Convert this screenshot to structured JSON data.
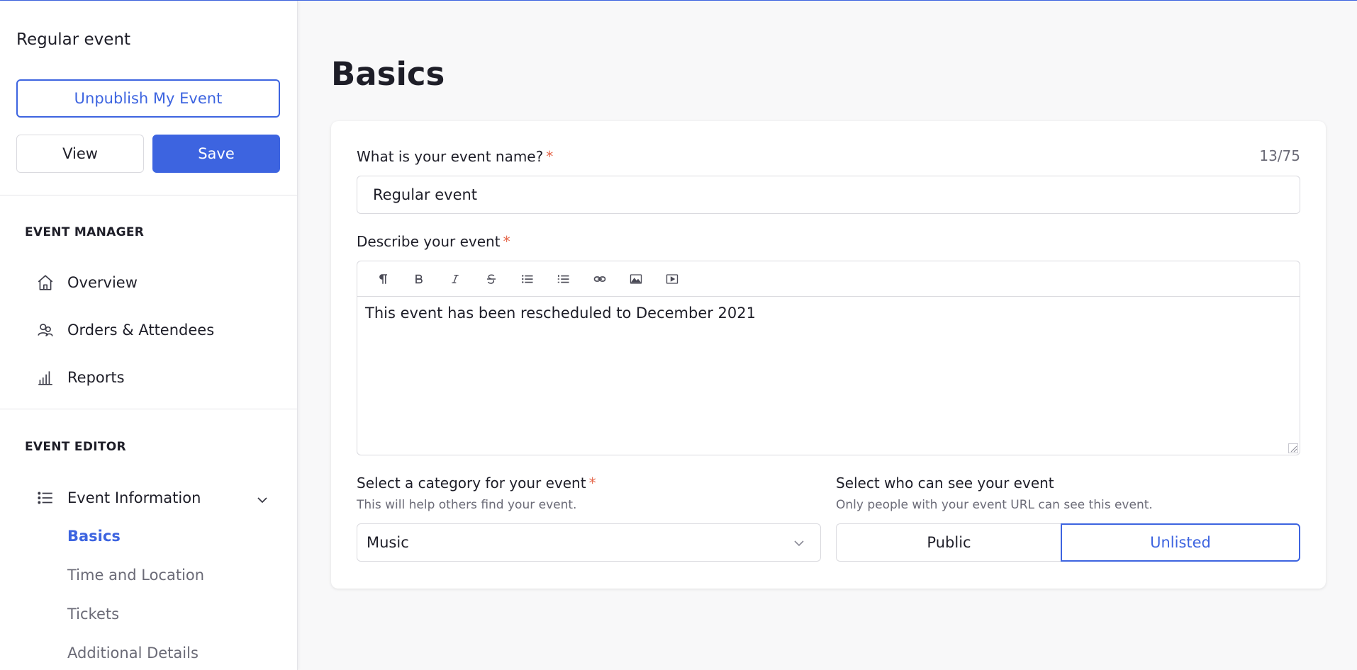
{
  "sidebar": {
    "event_title": "Regular event",
    "unpublish_label": "Unpublish My Event",
    "view_label": "View",
    "save_label": "Save",
    "manager_heading": "EVENT MANAGER",
    "manager_items": [
      {
        "label": "Overview",
        "icon": "home-icon"
      },
      {
        "label": "Orders & Attendees",
        "icon": "attendees-icon"
      },
      {
        "label": "Reports",
        "icon": "bar-chart-icon"
      }
    ],
    "editor_heading": "EVENT EDITOR",
    "event_information_label": "Event Information",
    "sub_items": [
      {
        "label": "Basics",
        "active": true
      },
      {
        "label": "Time and Location",
        "active": false
      },
      {
        "label": "Tickets",
        "active": false
      },
      {
        "label": "Additional Details",
        "active": false
      }
    ]
  },
  "main": {
    "title": "Basics",
    "name_label": "What is your event name?",
    "required_mark": "*",
    "name_counter": "13/75",
    "name_value": "Regular event",
    "describe_label": "Describe your event",
    "toolbar_icons": [
      "paragraph-icon",
      "bold-icon",
      "italic-icon",
      "strikethrough-icon",
      "bullet-list-icon",
      "numbered-list-icon",
      "link-icon",
      "image-icon",
      "video-icon"
    ],
    "description_text": "This event has been rescheduled to December 2021",
    "category_label": "Select a category for your event",
    "category_hint": "This will help others find your event.",
    "category_value": "Music",
    "visibility_label": "Select who can see your event",
    "visibility_hint": "Only people with your event URL can see this event.",
    "visibility_options": [
      "Public",
      "Unlisted"
    ],
    "visibility_selected": "Unlisted"
  },
  "colors": {
    "accent": "#3d64e0",
    "required": "#e5674b",
    "muted_text": "#6b6b77"
  }
}
